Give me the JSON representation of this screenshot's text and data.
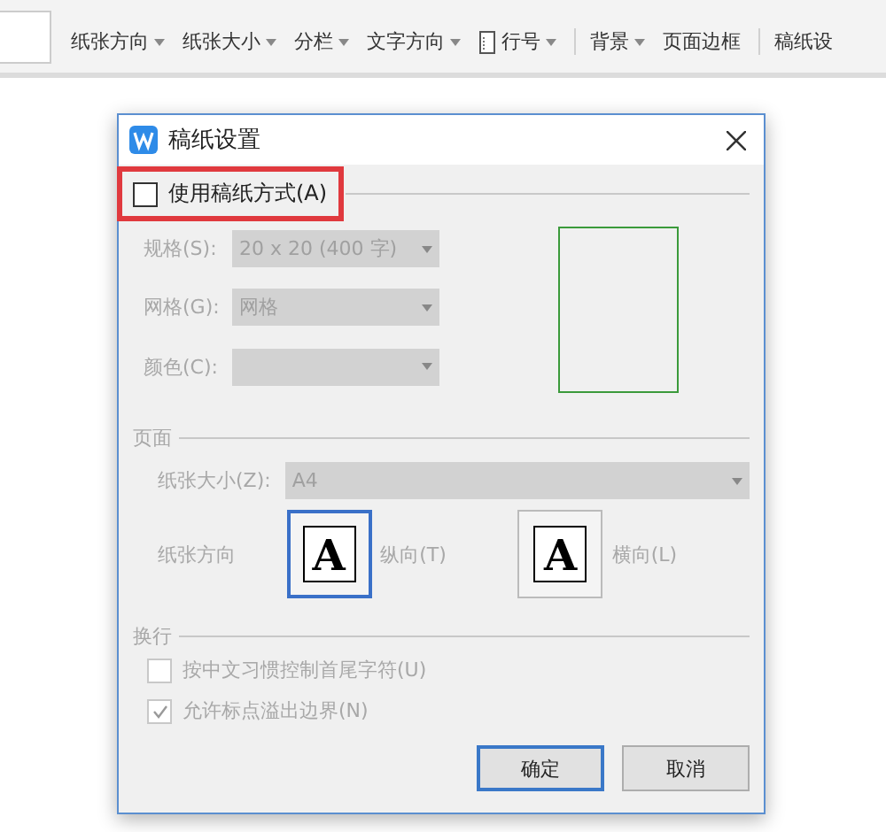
{
  "ribbon": {
    "items": [
      {
        "label": "纸张方向",
        "dropdown": true,
        "icon": false
      },
      {
        "label": "纸张大小",
        "dropdown": true,
        "icon": false
      },
      {
        "label": "分栏",
        "dropdown": true,
        "icon": false
      },
      {
        "label": "文字方向",
        "dropdown": true,
        "icon": false
      },
      {
        "label": "行号",
        "dropdown": true,
        "icon": true
      },
      {
        "label": "背景",
        "dropdown": true,
        "icon": false,
        "group_start": true
      },
      {
        "label": "页面边框",
        "dropdown": false,
        "icon": false
      },
      {
        "label": "稿纸设",
        "dropdown": false,
        "icon": false,
        "group_start": true
      }
    ]
  },
  "dialog": {
    "title": "稿纸设置",
    "use_grid": {
      "label": "使用稿纸方式(A)",
      "checked": false,
      "highlighted": true
    },
    "fields": [
      {
        "label": "规格(S):",
        "value": "20 x 20 (400 字)",
        "disabled": true
      },
      {
        "label": "网格(G):",
        "value": "网格",
        "disabled": true
      },
      {
        "label": "颜色(C):",
        "disabled": true
      }
    ],
    "page_section": "页面",
    "paper_size": {
      "label": "纸张大小(Z):",
      "value": "A4",
      "disabled": true
    },
    "orientation_label": "纸张方向",
    "orientations": [
      {
        "label": "纵向(T)",
        "glyph": "A",
        "selected": true
      },
      {
        "label": "横向(L)",
        "glyph": "A",
        "selected": false
      }
    ],
    "wrap_section": "换行",
    "options": [
      {
        "label": "按中文习惯控制首尾字符(U)",
        "checked": false,
        "disabled": true
      },
      {
        "label": "允许标点溢出边界(N)",
        "checked": true,
        "disabled": true
      }
    ],
    "buttons": [
      {
        "label": "确定",
        "default": true
      },
      {
        "label": "取消",
        "default": false
      }
    ]
  }
}
